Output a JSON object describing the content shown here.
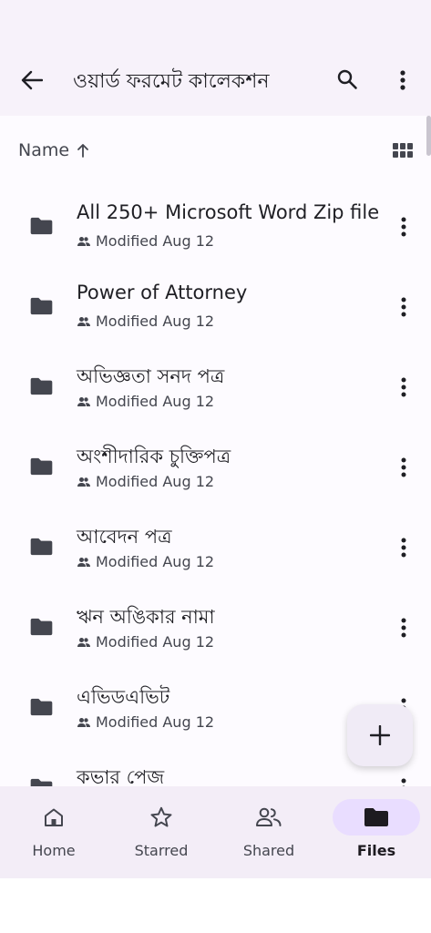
{
  "appbar": {
    "title": "ওয়ার্ড ফরমেট কালেকশন",
    "back_icon": "arrow-back-icon",
    "search_icon": "search-icon",
    "more_icon": "more-vert-icon"
  },
  "sort": {
    "label": "Name",
    "direction_icon": "arrow-upward-icon",
    "view_toggle_icon": "grid-view-icon"
  },
  "files": [
    {
      "name": "All 250+ Microsoft Word Zip file",
      "modified": "Modified Aug 12"
    },
    {
      "name": "Power of Attorney",
      "modified": "Modified Aug 12"
    },
    {
      "name": "অভিজ্ঞতা সনদ পত্র",
      "modified": "Modified Aug 12"
    },
    {
      "name": "অংশীদারিক চুক্তিপত্র",
      "modified": "Modified Aug 12"
    },
    {
      "name": "আবেদন পত্র",
      "modified": "Modified Aug 12"
    },
    {
      "name": "ঋন অঙিকার নামা",
      "modified": "Modified Aug 12"
    },
    {
      "name": "এভিডএভিট",
      "modified": "Modified Aug 12"
    },
    {
      "name": "কভার পেজ",
      "modified": ""
    }
  ],
  "fab": {
    "icon": "add-icon"
  },
  "nav": [
    {
      "label": "Home",
      "icon": "home-icon"
    },
    {
      "label": "Starred",
      "icon": "star-icon"
    },
    {
      "label": "Shared",
      "icon": "people-icon"
    },
    {
      "label": "Files",
      "icon": "folder-icon",
      "active": true
    }
  ],
  "colors": {
    "background": "#f7f2fa",
    "list_background": "#fdfbff",
    "nav_background": "#f3edf7",
    "active_indicator": "#e9ddff",
    "text_primary": "#1f1f24",
    "text_secondary": "#44464f"
  }
}
